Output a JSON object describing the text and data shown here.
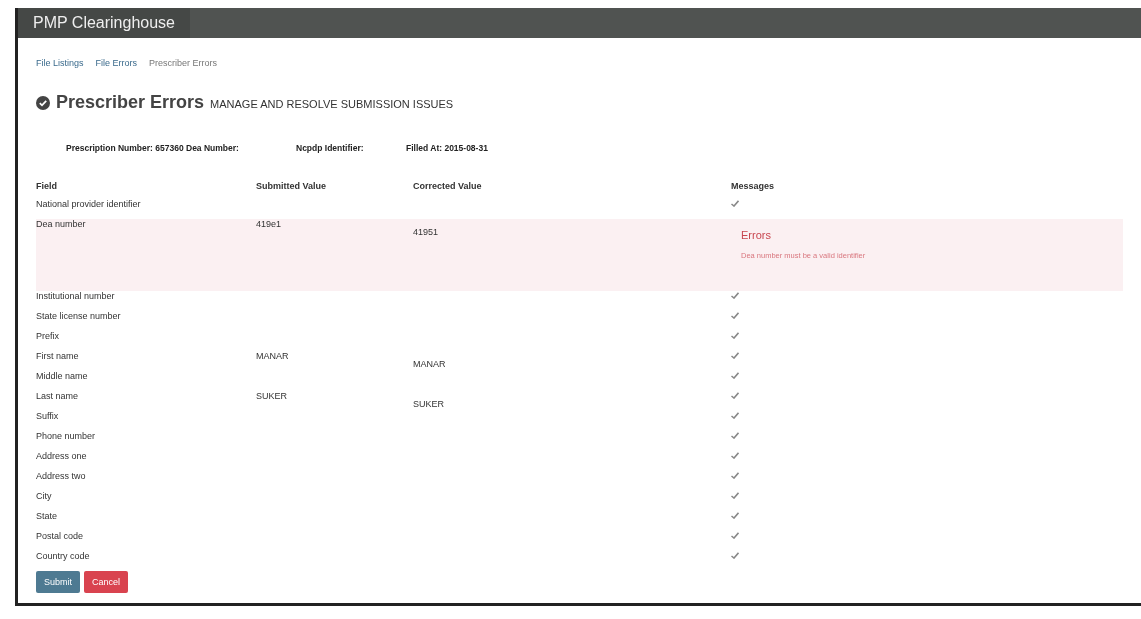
{
  "navbar": {
    "brand": "PMP Clearinghouse"
  },
  "breadcrumbs": [
    {
      "label": "File Listings",
      "kind": "link"
    },
    {
      "label": "File Errors",
      "kind": "link"
    },
    {
      "label": "Prescriber Errors",
      "kind": "current"
    }
  ],
  "heading": {
    "title": "Prescriber Errors",
    "subtitle": "MANAGE AND RESOLVE SUBMISSION ISSUES"
  },
  "summary": [
    "Prescription Number: 657360 Dea Number:",
    "Ncpdp Identifier:",
    "Filled At: 2015-08-31"
  ],
  "table": {
    "columns": [
      "Field",
      "Submitted Value",
      "Corrected Value",
      "Messages"
    ],
    "rows": [
      {
        "field": "National provider identifier",
        "kind": "ok"
      },
      {
        "field": "Dea number",
        "submitted": "419e1",
        "corrected": "41951",
        "kind": "error",
        "error_title": "Errors",
        "error_message": "Dea number must be a valid identifier"
      },
      {
        "field": "Institutional number",
        "kind": "ok"
      },
      {
        "field": "State license number",
        "kind": "ok"
      },
      {
        "field": "Prefix",
        "kind": "ok"
      },
      {
        "field": "First name",
        "submitted": "MANAR",
        "corrected": "MANAR",
        "kind": "ok"
      },
      {
        "field": "Middle name",
        "kind": "ok"
      },
      {
        "field": "Last name",
        "submitted": "SUKER",
        "corrected": "SUKER",
        "kind": "ok"
      },
      {
        "field": "Suffix",
        "kind": "ok"
      },
      {
        "field": "Phone number",
        "kind": "ok"
      },
      {
        "field": "Address one",
        "kind": "ok"
      },
      {
        "field": "Address two",
        "kind": "ok"
      },
      {
        "field": "City",
        "kind": "ok"
      },
      {
        "field": "State",
        "kind": "ok"
      },
      {
        "field": "Postal code",
        "kind": "ok"
      },
      {
        "field": "Country code",
        "kind": "ok"
      }
    ]
  },
  "buttons": [
    {
      "label": "Submit",
      "kind": "primary"
    },
    {
      "label": "Cancel",
      "kind": "danger"
    }
  ]
}
